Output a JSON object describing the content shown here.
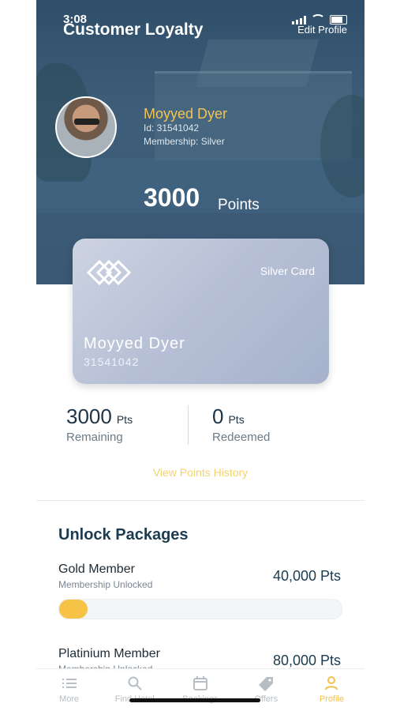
{
  "status": {
    "time": "3:08"
  },
  "header": {
    "title": "Customer Loyalty",
    "edit_label": "Edit Profile"
  },
  "profile": {
    "name": "Moyyed Dyer",
    "id_text": "Id: 31541042",
    "membership_text": "Membership: Silver",
    "points": "3000",
    "points_label": "Points"
  },
  "card": {
    "type": "Silver Card",
    "holder": "Moyyed Dyer",
    "number": "31541042"
  },
  "stats": {
    "remaining_value": "3000",
    "remaining_unit": "Pts",
    "remaining_label": "Remaining",
    "redeemed_value": "0",
    "redeemed_unit": "Pts",
    "redeemed_label": "Redeemed"
  },
  "view_history": "View Points History",
  "packages": {
    "title": "Unlock Packages",
    "items": [
      {
        "name": "Gold Member",
        "status": "Membership Unlocked",
        "points": "40,000 Pts",
        "progress": 0.1
      },
      {
        "name": "Platinium Member",
        "status": "Membership Unlocked",
        "points": "80,000 Pts"
      }
    ]
  },
  "tabs": [
    {
      "label": "More",
      "icon": "list-icon"
    },
    {
      "label": "Find Hotel",
      "icon": "search-icon"
    },
    {
      "label": "Bookings",
      "icon": "calendar-icon"
    },
    {
      "label": "Offers",
      "icon": "tag-icon"
    },
    {
      "label": "Profile",
      "icon": "user-icon",
      "active": true
    }
  ],
  "colors": {
    "accent": "#f2c14d",
    "header": "#3a5873",
    "title_dark": "#1b3b4f"
  }
}
